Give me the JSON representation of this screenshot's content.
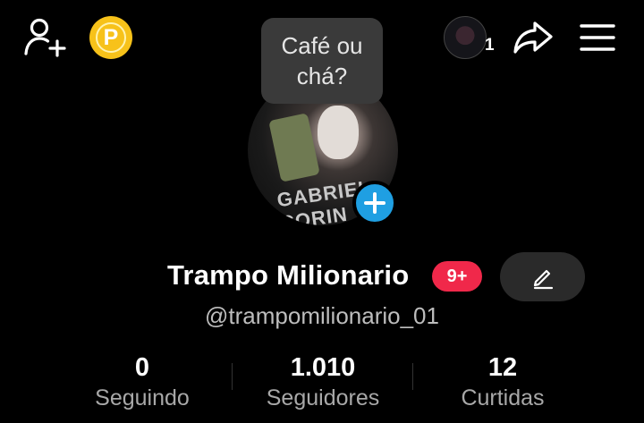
{
  "tooltip": {
    "text": "Café ou chá?"
  },
  "header": {
    "coin_symbol": "P",
    "stories_count": "1"
  },
  "profile": {
    "avatar_text": "GABRIEL CORIN",
    "name": "Trampo Milionario",
    "badge": "9+",
    "handle": "@trampomilionario_01"
  },
  "stats": [
    {
      "value": "0",
      "label": "Seguindo"
    },
    {
      "value": "1.010",
      "label": "Seguidores"
    },
    {
      "value": "12",
      "label": "Curtidas"
    }
  ],
  "icons": {
    "add_user": "add-user-icon",
    "coin": "coin-icon",
    "share": "share-icon",
    "menu": "menu-icon",
    "add_avatar": "plus-icon",
    "edit": "pencil-icon"
  },
  "colors": {
    "background": "#000000",
    "coin": "#f7c21a",
    "badge": "#f0284a",
    "add_avatar": "#1f9fe2",
    "edit_button": "#2a2a2a"
  }
}
